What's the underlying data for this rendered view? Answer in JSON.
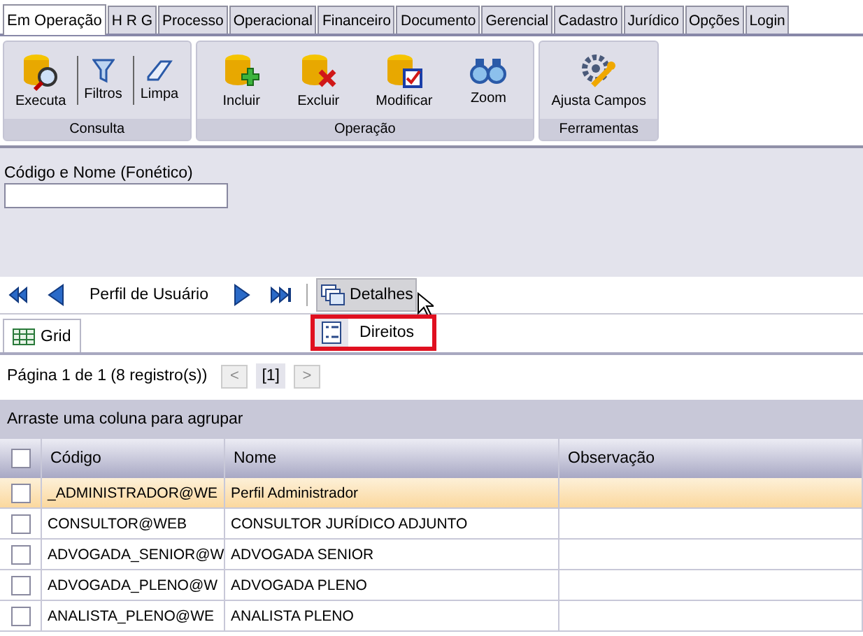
{
  "tabs": [
    {
      "label": "Em Operação",
      "selected": true
    },
    {
      "label": "H R G",
      "selected": false
    },
    {
      "label": "Processo",
      "selected": false
    },
    {
      "label": "Operacional",
      "selected": false
    },
    {
      "label": "Financeiro",
      "selected": false
    },
    {
      "label": "Documento",
      "selected": false
    },
    {
      "label": "Gerencial",
      "selected": false
    },
    {
      "label": "Cadastro",
      "selected": false
    },
    {
      "label": "Jurídico",
      "selected": false
    },
    {
      "label": "Opções",
      "selected": false
    },
    {
      "label": "Login",
      "selected": false
    }
  ],
  "ribbon_groups": [
    {
      "title": "Consulta",
      "buttons": [
        {
          "kind": "execute",
          "label": "Executa"
        },
        {
          "kind": "filter",
          "label": "Filtros"
        },
        {
          "kind": "eraser",
          "label": "Limpa"
        }
      ]
    },
    {
      "title": "Operação",
      "buttons": [
        {
          "kind": "add",
          "label": "Incluir"
        },
        {
          "kind": "delete",
          "label": "Excluir"
        },
        {
          "kind": "modify",
          "label": "Modificar"
        },
        {
          "kind": "zoom",
          "label": "Zoom"
        }
      ]
    },
    {
      "title": "Ferramentas",
      "buttons": [
        {
          "kind": "tools",
          "label": "Ajusta Campos"
        }
      ]
    }
  ],
  "filter": {
    "label": "Código e Nome (Fonético)"
  },
  "navigator": {
    "title": "Perfil de Usuário",
    "details_button": "Detalhes",
    "menu": [
      {
        "label": "Direitos",
        "highlighted": true
      }
    ]
  },
  "view_tabs": [
    {
      "label": "Grid",
      "selected": true
    }
  ],
  "pager": {
    "info": "Página 1 de 1 (8 registro(s))",
    "prev": "<",
    "page": "[1]",
    "next": ">"
  },
  "group_hint": "Arraste uma coluna para agrupar",
  "table": {
    "select_all_checked": false,
    "columns": [
      "Código",
      "Nome",
      "Observação"
    ],
    "rows": [
      {
        "cells": [
          "_ADMINISTRADOR@WE",
          "Perfil Administrador",
          ""
        ],
        "selected": true,
        "checked": false
      },
      {
        "cells": [
          "CONSULTOR@WEB",
          "CONSULTOR JURÍDICO ADJUNTO",
          ""
        ],
        "selected": false,
        "checked": false
      },
      {
        "cells": [
          "ADVOGADA_SENIOR@W",
          "ADVOGADA SENIOR",
          ""
        ],
        "selected": false,
        "checked": false
      },
      {
        "cells": [
          "ADVOGADA_PLENO@W",
          "ADVOGADA PLENO",
          ""
        ],
        "selected": false,
        "checked": false
      },
      {
        "cells": [
          "ANALISTA_PLENO@WE",
          "ANALISTA PLENO",
          ""
        ],
        "selected": false,
        "checked": false
      }
    ]
  }
}
